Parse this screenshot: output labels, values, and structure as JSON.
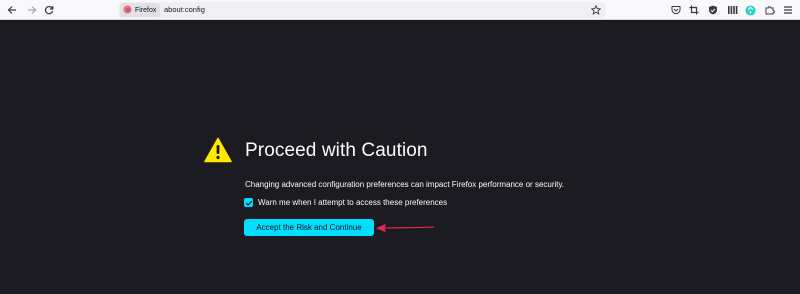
{
  "browser": {
    "identity_label": "Firefox",
    "url": "about:config"
  },
  "page": {
    "title": "Proceed with Caution",
    "description": "Changing advanced configuration preferences can impact Firefox performance or security.",
    "checkbox_label": "Warn me when I attempt to access these preferences",
    "checkbox_checked": true,
    "accept_button_label": "Accept the Risk and Continue"
  },
  "colors": {
    "page_background": "#1c1b22",
    "accent": "#00ddff",
    "warning": "#ffe900",
    "annotation_arrow": "#e22850"
  },
  "icons": [
    "back-icon",
    "forward-icon",
    "reload-icon",
    "firefox-logo-icon",
    "bookmark-star-icon",
    "pocket-icon",
    "screenshot-icon",
    "shield-icon",
    "library-icon",
    "extension-badge-icon",
    "extensions-icon",
    "menu-icon",
    "warning-icon",
    "checkmark-icon"
  ]
}
